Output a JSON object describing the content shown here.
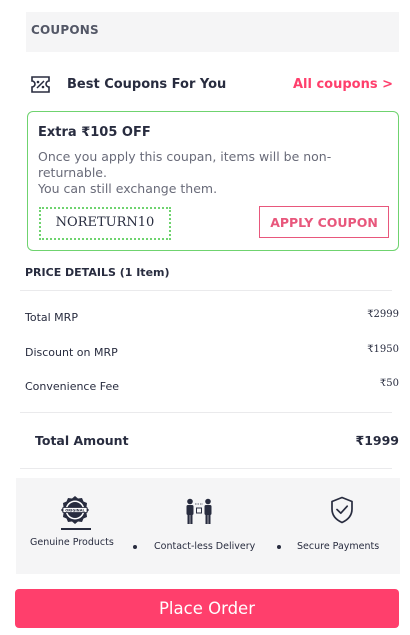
{
  "coupons": {
    "header": "COUPONS",
    "best_label": "Best Coupons For You",
    "all_link": "All coupons >",
    "card": {
      "title": "Extra ₹105 OFF",
      "desc_line1": "Once you apply this coupan, items will be non-",
      "desc_line2": "returnable.",
      "desc_line3": "You can still exchange them.",
      "code": "NORETURN10",
      "apply_label": "APPLY COUPON"
    }
  },
  "price_details": {
    "title": "PRICE DETAILS (1 Item)",
    "rows": [
      {
        "label": "Total MRP",
        "value": "₹2999"
      },
      {
        "label": "Discount on MRP",
        "value": "₹1950"
      },
      {
        "label": "Convenience Fee",
        "value": "₹50"
      }
    ],
    "total_label": "Total Amount",
    "total_value": "₹1999"
  },
  "trust": {
    "items": [
      {
        "label": "Genuine Products",
        "icon": "original-seal-icon",
        "badge_text": "ORIGINAL"
      },
      {
        "label": "Contact-less Delivery",
        "icon": "contactless-delivery-icon"
      },
      {
        "label": "Secure Payments",
        "icon": "shield-check-icon"
      }
    ]
  },
  "place_order": {
    "label": "Place Order"
  },
  "colors": {
    "accent": "#ff3f6c",
    "coupon_border": "#6fd36f",
    "panel_bg": "#f5f5f6",
    "text": "#282c3f"
  }
}
